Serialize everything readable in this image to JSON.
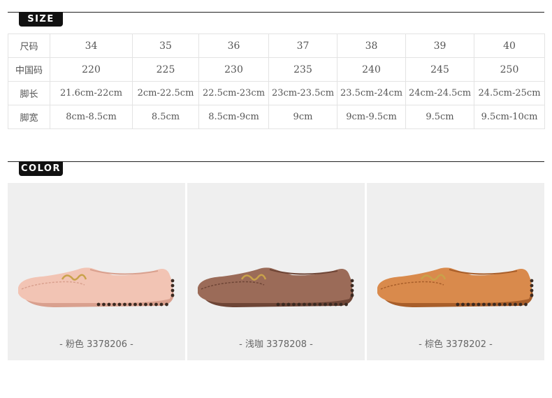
{
  "size_section": {
    "tag": "SIZE",
    "rows": [
      {
        "label": "尺码",
        "values": [
          "34",
          "35",
          "36",
          "37",
          "38",
          "39",
          "40"
        ]
      },
      {
        "label": "中国码",
        "values": [
          "220",
          "225",
          "230",
          "235",
          "240",
          "245",
          "250"
        ]
      },
      {
        "label": "脚长",
        "values": [
          "21.6cm-22cm",
          "2cm-22.5cm",
          "22.5cm-23cm",
          "23cm-23.5cm",
          "23.5cm-24cm",
          "24cm-24.5cm",
          "24.5cm-25cm"
        ]
      },
      {
        "label": "脚宽",
        "values": [
          "8cm-8.5cm",
          "8.5cm",
          "8.5cm-9cm",
          "9cm",
          "9cm-9.5cm",
          "9.5cm",
          "9.5cm-10cm"
        ]
      }
    ]
  },
  "color_section": {
    "tag": "COLOR",
    "items": [
      {
        "caption": "- 粉色 3378206 -",
        "color": "#f2c4b4",
        "shade": "#d9a08e"
      },
      {
        "caption": "- 浅咖 3378208 -",
        "color": "#9b6b58",
        "shade": "#6e4536"
      },
      {
        "caption": "- 棕色 3378202 -",
        "color": "#d98a4c",
        "shade": "#a85e2a"
      }
    ]
  }
}
